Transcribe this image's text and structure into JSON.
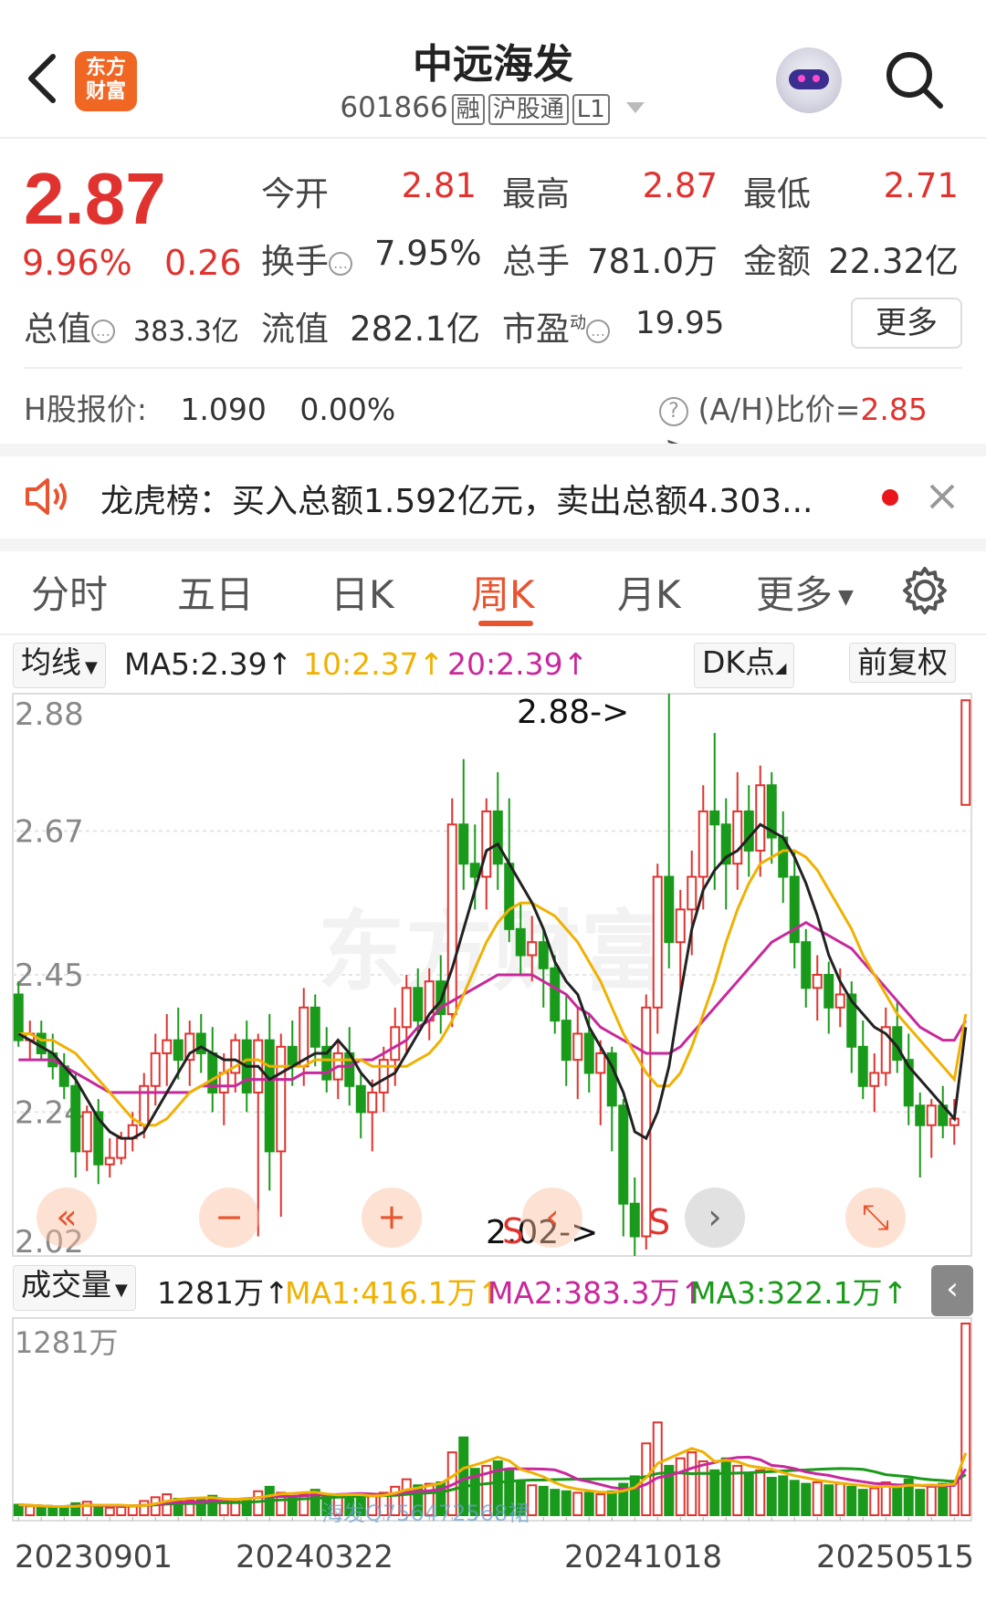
{
  "header": {
    "back_icon": "chevron-left-icon",
    "logo_text_1": "东方",
    "logo_text_2": "财富",
    "title": "中远海发",
    "code": "601866",
    "tags": [
      "融",
      "沪股通",
      "L1"
    ],
    "assistant_icon": "robot-avatar-icon",
    "search_icon": "search-icon"
  },
  "quote": {
    "price": "2.87",
    "change_pct": "9.96%",
    "change": "0.26",
    "open_label": "今开",
    "open": "2.81",
    "high_label": "最高",
    "high": "2.87",
    "low_label": "最低",
    "low": "2.71",
    "turnover_label": "换手",
    "turnover": "7.95%",
    "volume_label": "总手",
    "volume": "781.0万",
    "amount_label": "金额",
    "amount": "22.32亿",
    "mktcap_label": "总值",
    "mktcap": "383.3亿",
    "float_label": "流值",
    "float": "282.1亿",
    "pe_label": "市盈",
    "pe_sup": "动",
    "pe": "19.95",
    "more_label": "更多"
  },
  "h_share": {
    "label": "H股报价:",
    "price": "1.090",
    "change": "0.00%",
    "ah_label": "(A/H)比价=",
    "ah_value": "2.85",
    "arrow": ">"
  },
  "notice": {
    "text": "龙虎榜：买入总额1.592亿元，卖出总额4.303..."
  },
  "tabs": [
    "分时",
    "五日",
    "日K",
    "周K",
    "月K",
    "更多"
  ],
  "active_tab": "周K",
  "ma_row": {
    "selector": "均线",
    "ma5": "MA5:2.39↑",
    "ma10": "10:2.37↑",
    "ma20": "20:2.39↑",
    "dk": "DK点",
    "adjust": "前复权"
  },
  "price_axis": [
    "2.88",
    "2.67",
    "2.45",
    "2.24",
    "2.02"
  ],
  "annotations": {
    "high_mark": "2.88->",
    "low_mark": "2.02->",
    "signal_1": "S",
    "signal_2": "S"
  },
  "watermark": "东方财富",
  "vol_row": {
    "selector": "成交量",
    "value": "1281万↑",
    "ma1": "MA1:416.1万↑",
    "ma2": "MA2:383.3万↑",
    "ma3": "MA3:322.1万↑"
  },
  "vol_axis_top": "1281万",
  "vol_watermark": "海发Q756472568裙",
  "dates": [
    "20230901",
    "20240322",
    "20241018",
    "20250515"
  ],
  "colors": {
    "up": "#e0332f",
    "down": "#1a9a1a",
    "ma5": "#222222",
    "ma10": "#f0b100",
    "ma20": "#c8289c",
    "accent": "#e8542f"
  },
  "chart_data": {
    "type": "candlestick",
    "period": "weekly",
    "ylim": [
      2.02,
      2.88
    ],
    "y_ticks": [
      2.88,
      2.67,
      2.45,
      2.24,
      2.02
    ],
    "last": {
      "open": 2.71,
      "high": 2.87,
      "low": 2.71,
      "close": 2.87
    },
    "ohlc": [
      [
        2.42,
        2.44,
        2.34,
        2.35
      ],
      [
        2.35,
        2.38,
        2.32,
        2.36
      ],
      [
        2.36,
        2.38,
        2.32,
        2.33
      ],
      [
        2.33,
        2.36,
        2.29,
        2.31
      ],
      [
        2.31,
        2.33,
        2.26,
        2.28
      ],
      [
        2.28,
        2.3,
        2.14,
        2.18
      ],
      [
        2.18,
        2.25,
        2.15,
        2.24
      ],
      [
        2.24,
        2.26,
        2.13,
        2.16
      ],
      [
        2.16,
        2.2,
        2.14,
        2.17
      ],
      [
        2.17,
        2.21,
        2.16,
        2.2
      ],
      [
        2.2,
        2.24,
        2.18,
        2.22
      ],
      [
        2.22,
        2.3,
        2.2,
        2.28
      ],
      [
        2.28,
        2.36,
        2.25,
        2.33
      ],
      [
        2.33,
        2.39,
        2.28,
        2.35
      ],
      [
        2.35,
        2.4,
        2.29,
        2.32
      ],
      [
        2.32,
        2.38,
        2.28,
        2.36
      ],
      [
        2.36,
        2.39,
        2.3,
        2.33
      ],
      [
        2.33,
        2.37,
        2.24,
        2.27
      ],
      [
        2.27,
        2.33,
        2.22,
        2.3
      ],
      [
        2.3,
        2.36,
        2.27,
        2.35
      ],
      [
        2.35,
        2.38,
        2.24,
        2.27
      ],
      [
        2.27,
        2.36,
        2.05,
        2.35
      ],
      [
        2.35,
        2.39,
        2.12,
        2.18
      ],
      [
        2.18,
        2.36,
        2.08,
        2.34
      ],
      [
        2.34,
        2.38,
        2.28,
        2.31
      ],
      [
        2.31,
        2.43,
        2.28,
        2.4
      ],
      [
        2.4,
        2.42,
        2.31,
        2.34
      ],
      [
        2.34,
        2.37,
        2.27,
        2.29
      ],
      [
        2.29,
        2.35,
        2.26,
        2.33
      ],
      [
        2.33,
        2.37,
        2.25,
        2.28
      ],
      [
        2.28,
        2.3,
        2.2,
        2.24
      ],
      [
        2.24,
        2.29,
        2.18,
        2.27
      ],
      [
        2.27,
        2.34,
        2.24,
        2.32
      ],
      [
        2.32,
        2.4,
        2.28,
        2.37
      ],
      [
        2.37,
        2.45,
        2.33,
        2.43
      ],
      [
        2.43,
        2.46,
        2.36,
        2.38
      ],
      [
        2.38,
        2.46,
        2.35,
        2.44
      ],
      [
        2.44,
        2.48,
        2.36,
        2.39
      ],
      [
        2.39,
        2.72,
        2.37,
        2.68
      ],
      [
        2.68,
        2.78,
        2.58,
        2.62
      ],
      [
        2.62,
        2.68,
        2.55,
        2.6
      ],
      [
        2.6,
        2.72,
        2.55,
        2.7
      ],
      [
        2.7,
        2.76,
        2.58,
        2.62
      ],
      [
        2.62,
        2.72,
        2.5,
        2.52
      ],
      [
        2.52,
        2.56,
        2.45,
        2.48
      ],
      [
        2.48,
        2.54,
        2.44,
        2.5
      ],
      [
        2.5,
        2.52,
        2.4,
        2.46
      ],
      [
        2.46,
        2.48,
        2.36,
        2.38
      ],
      [
        2.38,
        2.42,
        2.28,
        2.32
      ],
      [
        2.32,
        2.4,
        2.26,
        2.36
      ],
      [
        2.36,
        2.39,
        2.27,
        2.3
      ],
      [
        2.3,
        2.35,
        2.22,
        2.33
      ],
      [
        2.33,
        2.34,
        2.18,
        2.25
      ],
      [
        2.25,
        2.26,
        2.05,
        2.1
      ],
      [
        2.1,
        2.14,
        2.02,
        2.05
      ],
      [
        2.05,
        2.42,
        2.03,
        2.4
      ],
      [
        2.4,
        2.62,
        2.36,
        2.6
      ],
      [
        2.6,
        2.88,
        2.46,
        2.5
      ],
      [
        2.5,
        2.58,
        2.42,
        2.55
      ],
      [
        2.55,
        2.64,
        2.48,
        2.6
      ],
      [
        2.6,
        2.74,
        2.55,
        2.7
      ],
      [
        2.7,
        2.82,
        2.58,
        2.68
      ],
      [
        2.68,
        2.72,
        2.55,
        2.62
      ],
      [
        2.62,
        2.76,
        2.58,
        2.7
      ],
      [
        2.7,
        2.74,
        2.6,
        2.64
      ],
      [
        2.64,
        2.77,
        2.6,
        2.74
      ],
      [
        2.74,
        2.76,
        2.62,
        2.66
      ],
      [
        2.66,
        2.7,
        2.56,
        2.6
      ],
      [
        2.6,
        2.64,
        2.46,
        2.5
      ],
      [
        2.5,
        2.52,
        2.4,
        2.43
      ],
      [
        2.43,
        2.48,
        2.38,
        2.45
      ],
      [
        2.45,
        2.47,
        2.36,
        2.4
      ],
      [
        2.4,
        2.46,
        2.37,
        2.42
      ],
      [
        2.42,
        2.44,
        2.3,
        2.34
      ],
      [
        2.34,
        2.38,
        2.26,
        2.28
      ],
      [
        2.28,
        2.33,
        2.24,
        2.3
      ],
      [
        2.3,
        2.4,
        2.28,
        2.37
      ],
      [
        2.37,
        2.41,
        2.3,
        2.32
      ],
      [
        2.32,
        2.36,
        2.22,
        2.25
      ],
      [
        2.25,
        2.27,
        2.14,
        2.22
      ],
      [
        2.22,
        2.26,
        2.17,
        2.25
      ],
      [
        2.25,
        2.28,
        2.2,
        2.22
      ],
      [
        2.22,
        2.26,
        2.19,
        2.23
      ],
      [
        2.71,
        2.87,
        2.71,
        2.87
      ]
    ],
    "volume_max": 1281,
    "volume_unit": "万",
    "volume": [
      70,
      60,
      55,
      50,
      55,
      80,
      90,
      60,
      50,
      55,
      60,
      95,
      120,
      140,
      110,
      100,
      110,
      130,
      90,
      100,
      110,
      160,
      190,
      150,
      120,
      140,
      170,
      130,
      120,
      125,
      140,
      130,
      150,
      190,
      240,
      200,
      210,
      220,
      420,
      520,
      310,
      330,
      360,
      300,
      230,
      200,
      190,
      170,
      160,
      150,
      150,
      140,
      160,
      210,
      260,
      480,
      620,
      330,
      380,
      420,
      360,
      300,
      380,
      330,
      280,
      300,
      250,
      260,
      230,
      210,
      220,
      200,
      210,
      190,
      170,
      180,
      220,
      190,
      240,
      170,
      190,
      210,
      230,
      1281
    ],
    "ma5": [
      2.36,
      2.35,
      2.34,
      2.33,
      2.31,
      2.29,
      2.26,
      2.23,
      2.21,
      2.2,
      2.2,
      2.21,
      2.24,
      2.27,
      2.3,
      2.33,
      2.34,
      2.33,
      2.32,
      2.32,
      2.31,
      2.31,
      2.29,
      2.3,
      2.31,
      2.32,
      2.33,
      2.33,
      2.35,
      2.33,
      2.3,
      2.28,
      2.29,
      2.3,
      2.33,
      2.36,
      2.39,
      2.41,
      2.46,
      2.52,
      2.58,
      2.64,
      2.65,
      2.62,
      2.59,
      2.56,
      2.52,
      2.47,
      2.44,
      2.42,
      2.37,
      2.34,
      2.31,
      2.27,
      2.21,
      2.2,
      2.24,
      2.31,
      2.42,
      2.52,
      2.58,
      2.61,
      2.63,
      2.64,
      2.66,
      2.68,
      2.67,
      2.66,
      2.63,
      2.59,
      2.54,
      2.48,
      2.44,
      2.41,
      2.39,
      2.37,
      2.36,
      2.34,
      2.31,
      2.29,
      2.27,
      2.25,
      2.23,
      2.37
    ],
    "ma10": [
      2.36,
      2.36,
      2.35,
      2.35,
      2.34,
      2.33,
      2.31,
      2.29,
      2.27,
      2.25,
      2.23,
      2.22,
      2.22,
      2.23,
      2.25,
      2.27,
      2.28,
      2.29,
      2.3,
      2.31,
      2.32,
      2.32,
      2.31,
      2.31,
      2.31,
      2.31,
      2.32,
      2.32,
      2.32,
      2.32,
      2.32,
      2.31,
      2.31,
      2.31,
      2.31,
      2.32,
      2.33,
      2.35,
      2.38,
      2.42,
      2.46,
      2.5,
      2.53,
      2.55,
      2.56,
      2.56,
      2.55,
      2.54,
      2.52,
      2.5,
      2.47,
      2.44,
      2.4,
      2.36,
      2.33,
      2.3,
      2.28,
      2.28,
      2.3,
      2.34,
      2.39,
      2.44,
      2.5,
      2.55,
      2.59,
      2.62,
      2.63,
      2.64,
      2.64,
      2.63,
      2.61,
      2.58,
      2.55,
      2.52,
      2.48,
      2.45,
      2.42,
      2.39,
      2.37,
      2.35,
      2.33,
      2.31,
      2.29,
      2.39
    ],
    "ma20": [
      2.32,
      2.32,
      2.32,
      2.32,
      2.31,
      2.3,
      2.29,
      2.28,
      2.27,
      2.27,
      2.27,
      2.27,
      2.27,
      2.27,
      2.27,
      2.27,
      2.28,
      2.28,
      2.28,
      2.28,
      2.29,
      2.29,
      2.29,
      2.29,
      2.29,
      2.3,
      2.3,
      2.3,
      2.31,
      2.31,
      2.32,
      2.32,
      2.33,
      2.34,
      2.35,
      2.37,
      2.38,
      2.4,
      2.41,
      2.42,
      2.43,
      2.44,
      2.45,
      2.45,
      2.45,
      2.45,
      2.44,
      2.43,
      2.42,
      2.4,
      2.39,
      2.37,
      2.36,
      2.35,
      2.34,
      2.33,
      2.33,
      2.33,
      2.34,
      2.36,
      2.38,
      2.4,
      2.42,
      2.44,
      2.46,
      2.48,
      2.5,
      2.51,
      2.52,
      2.53,
      2.52,
      2.51,
      2.5,
      2.49,
      2.47,
      2.45,
      2.43,
      2.41,
      2.39,
      2.37,
      2.36,
      2.35,
      2.35,
      2.38
    ]
  }
}
